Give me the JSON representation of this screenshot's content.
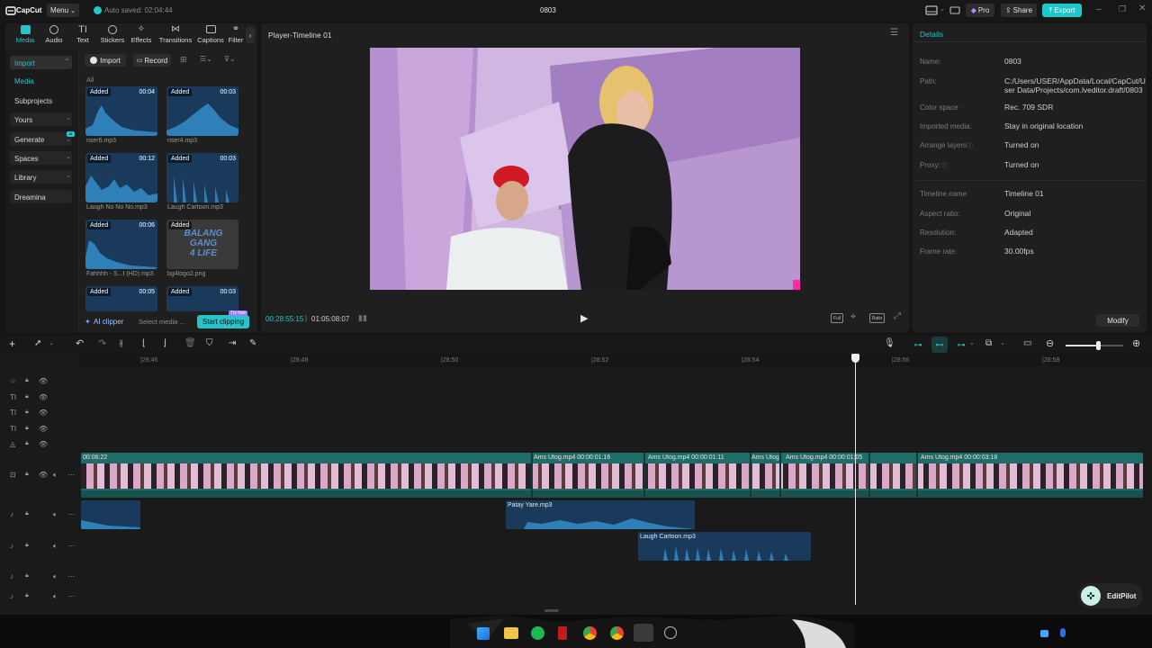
{
  "titlebar": {
    "app_name": "CapCut",
    "menu_label": "Menu",
    "autosave": "Auto saved: 02:04:44",
    "project_title": "0803",
    "pro_label": "Pro",
    "share_label": "Share",
    "export_label": "Export"
  },
  "toolbar": {
    "tabs": [
      {
        "label": "Media",
        "icon": "media-icon",
        "active": true
      },
      {
        "label": "Audio",
        "icon": "audio-icon"
      },
      {
        "label": "Text",
        "icon": "text-icon"
      },
      {
        "label": "Stickers",
        "icon": "stickers-icon"
      },
      {
        "label": "Effects",
        "icon": "effects-icon"
      },
      {
        "label": "Transitions",
        "icon": "transitions-icon"
      },
      {
        "label": "Captions",
        "icon": "captions-icon"
      },
      {
        "label": "Filter",
        "icon": "filter-icon"
      }
    ]
  },
  "sidebar": {
    "items": [
      {
        "label": "Import",
        "active": true
      },
      {
        "label": "Media"
      },
      {
        "label": "Subprojects"
      },
      {
        "label": "Yours"
      },
      {
        "label": "Generate"
      },
      {
        "label": "Spaces"
      },
      {
        "label": "Library"
      },
      {
        "label": "Dreamina"
      }
    ]
  },
  "media": {
    "import_label": "Import",
    "record_label": "Record",
    "filter_all": "All",
    "items": [
      {
        "name": "riser6.mp3",
        "tag": "Added",
        "duration": "00:04"
      },
      {
        "name": "riser4.mp3",
        "tag": "Added",
        "duration": "00:03"
      },
      {
        "name": "Laugh No No No.mp3",
        "tag": "Added",
        "duration": "00:12"
      },
      {
        "name": "Laugh Cartoon.mp3",
        "tag": "Added",
        "duration": "00:03"
      },
      {
        "name": "Fahhhh - S...t (HD).mp3",
        "tag": "Added",
        "duration": "00:06"
      },
      {
        "name": "bg4logo2.png",
        "tag": "Added",
        "duration": ""
      },
      {
        "name": "",
        "tag": "Added",
        "duration": "00:05"
      },
      {
        "name": "",
        "tag": "Added",
        "duration": "00:03"
      }
    ],
    "logo_text": "BALANG GANG 4 LIFE",
    "ai_clipper": "AI clipper",
    "select_media": "Select media ...",
    "start_clipping": "Start clipping",
    "try_free": "Try free"
  },
  "player": {
    "title": "Player-Timeline 01",
    "current_time": "00:28:55:15",
    "total_time": "01:05:08:07",
    "full_label": "Full",
    "ratio_label": "Ratio"
  },
  "details": {
    "heading": "Details",
    "rows": [
      {
        "label": "Name:",
        "value": "0803"
      },
      {
        "label": "Path:",
        "value": "C:/Users/USER/AppData/Local/CapCut/User Data/Projects/com.lveditor.draft/0803"
      },
      {
        "label": "Color space",
        "value": "Rec. 709 SDR"
      },
      {
        "label": "Imported media:",
        "value": "Stay in original location"
      },
      {
        "label": "Arrange layers",
        "value": "Turned on"
      },
      {
        "label": "Proxy:",
        "value": "Turned on"
      },
      {
        "label": "Timeline name",
        "value": "Timeline 01"
      },
      {
        "label": "Aspect ratio:",
        "value": "Original"
      },
      {
        "label": "Resolution:",
        "value": "Adapted"
      },
      {
        "label": "Frame rate:",
        "value": "30.00fps"
      }
    ],
    "modify_label": "Modify"
  },
  "timeline": {
    "ticks": [
      "|28:46",
      "|28:48",
      "|28:50",
      "|28:52",
      "|28:54",
      "|28:56",
      "|28:58"
    ],
    "video_captions": [
      {
        "text": "00:06:22"
      },
      {
        "text": "Ams Utog.mp4  00:00:01:16"
      },
      {
        "text": "Ams Utog.mp4  00:00:01:11"
      },
      {
        "text": "Ams Utog"
      },
      {
        "text": "Ams Utog.mp4  00:00:01:05"
      },
      {
        "text": "Ams Utog.mp4  00:00:03:18"
      }
    ],
    "audio_clips": [
      {
        "name": "Patay Yare.mp3"
      },
      {
        "name": "Laugh Cartoon.mp3"
      }
    ]
  },
  "assistant": {
    "label": "EditPilot"
  },
  "colors": {
    "accent": "#27c5c9",
    "clip_teal": "#1f6d69",
    "audio_blue": "#1a3a5c",
    "export": "#1fc8c8"
  }
}
